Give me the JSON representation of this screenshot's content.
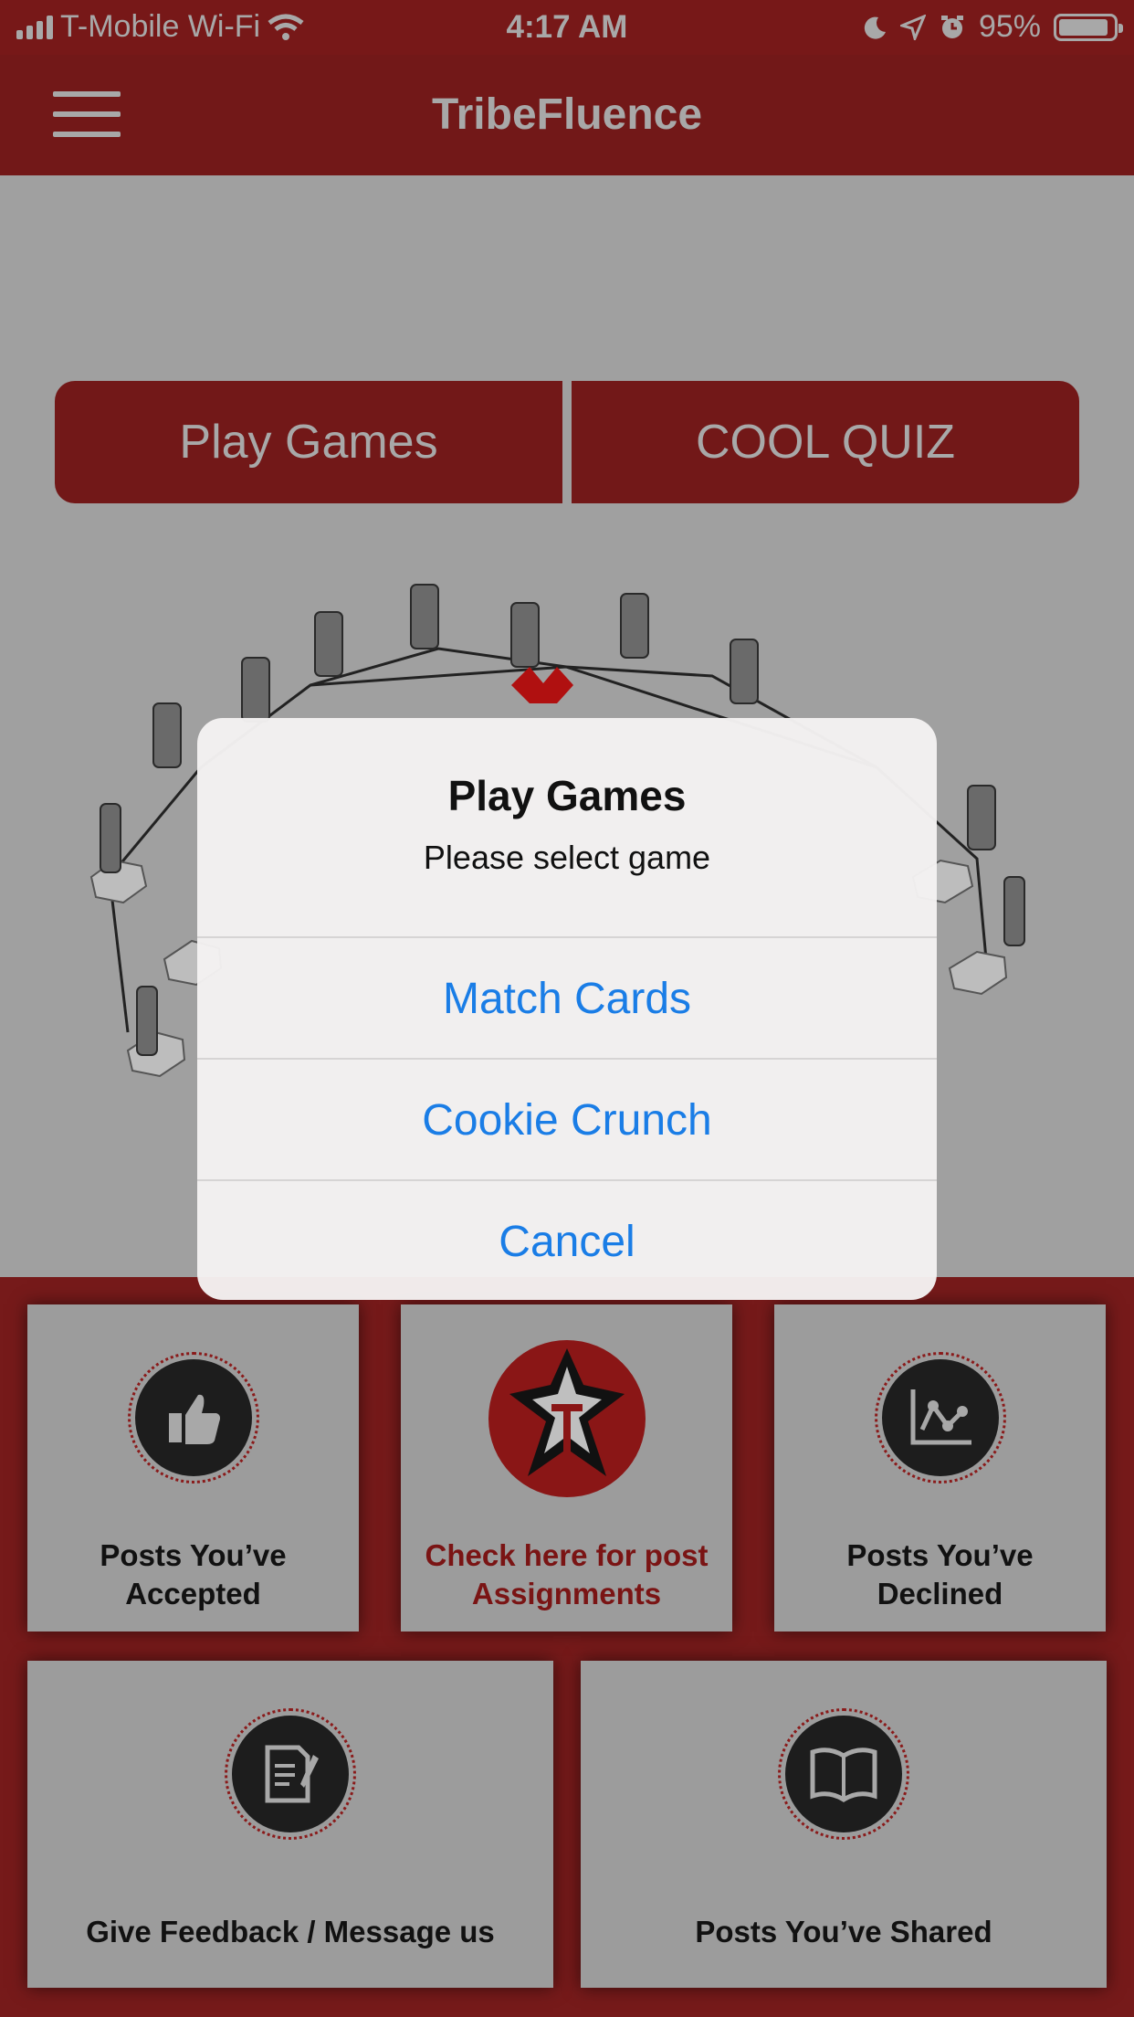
{
  "status_bar": {
    "carrier": "T-Mobile Wi-Fi",
    "time": "4:17 AM",
    "battery": "95%",
    "icons": [
      "signal-icon",
      "wifi-icon",
      "moon-icon",
      "location-icon",
      "alarm-icon",
      "battery-icon"
    ]
  },
  "navbar": {
    "title": "TribeFluence",
    "menu_icon": "hamburger-icon"
  },
  "top_buttons": {
    "play_games": "Play Games",
    "cool_quiz": "COOL QUIZ"
  },
  "tiles": [
    {
      "label": "Posts You’ve Accepted",
      "icon": "thumbs-up-icon"
    },
    {
      "label": "Check here for post Assignments",
      "icon": "tribal-logo-icon"
    },
    {
      "label": "Posts You’ve Declined",
      "icon": "chart-icon"
    },
    {
      "label": "Give Feedback / Message us",
      "icon": "document-edit-icon"
    },
    {
      "label": "Posts You’ve Shared",
      "icon": "book-icon"
    }
  ],
  "alert": {
    "title": "Play Games",
    "message": "Please select game",
    "actions": [
      "Match Cards",
      "Cookie Crunch",
      "Cancel"
    ]
  },
  "colors": {
    "brand": "#721818",
    "alert_action": "#1a7de6"
  }
}
